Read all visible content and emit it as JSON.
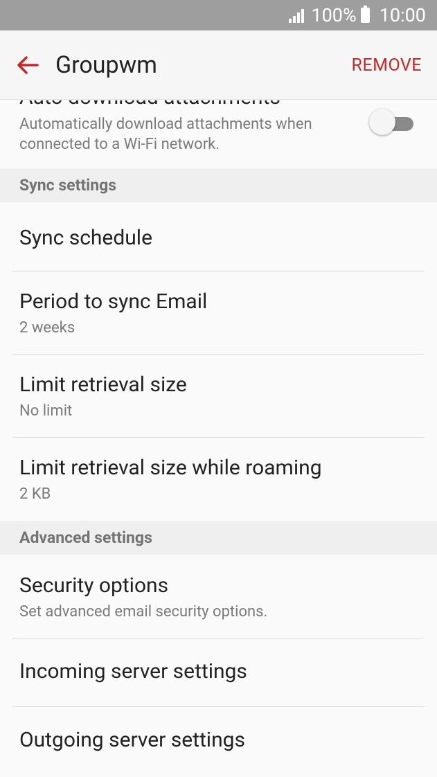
{
  "status_bar": {
    "battery_percent": "100%",
    "time": "10:00"
  },
  "app_bar": {
    "title": "Groupwm",
    "action": "REMOVE"
  },
  "auto_download": {
    "title": "Auto download attachments",
    "subtitle": "Automatically download attachments when connected to a Wi-Fi network.",
    "enabled": false
  },
  "sync_section": {
    "header": "Sync settings",
    "items": [
      {
        "title": "Sync schedule",
        "subtitle": ""
      },
      {
        "title": "Period to sync Email",
        "subtitle": "2 weeks"
      },
      {
        "title": "Limit retrieval size",
        "subtitle": "No limit"
      },
      {
        "title": "Limit retrieval size while roaming",
        "subtitle": "2 KB"
      }
    ]
  },
  "advanced_section": {
    "header": "Advanced settings",
    "items": [
      {
        "title": "Security options",
        "subtitle": "Set advanced email security options."
      },
      {
        "title": "Incoming server settings",
        "subtitle": ""
      },
      {
        "title": "Outgoing server settings",
        "subtitle": ""
      }
    ]
  },
  "colors": {
    "accent": "#c62828",
    "status_bar": "#9e9e9e"
  }
}
